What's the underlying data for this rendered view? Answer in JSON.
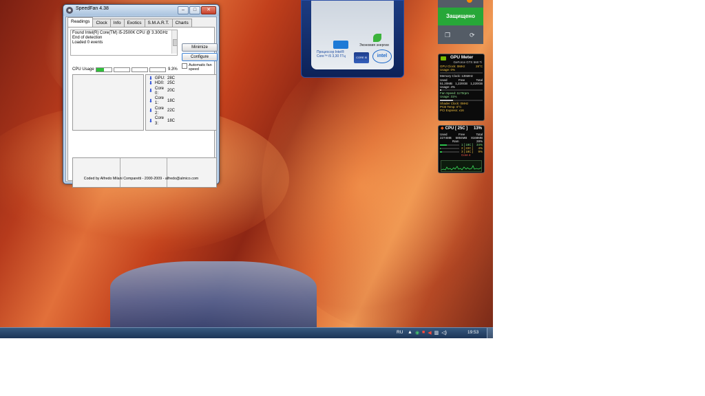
{
  "speedfan": {
    "title": "SpeedFan 4.38",
    "tabs": [
      "Readings",
      "Clock",
      "Info",
      "Exotics",
      "S.M.A.R.T.",
      "Charts"
    ],
    "log": [
      "Found Intel(R) Core(TM) i5-2500K CPU @ 3.30GHz",
      "End of detection",
      "Loaded 0 events"
    ],
    "minimize_label": "Minimize",
    "configure_label": "Configure",
    "auto_fan_label": "Automatic fan speed",
    "cpu_usage_label": "CPU Usage",
    "cpu_usage_value": "9.3%",
    "core_usage_fractions": [
      0.5,
      0,
      0,
      0
    ],
    "temps": [
      {
        "name": "GPU:",
        "value": "28C"
      },
      {
        "name": "HD0:",
        "value": "25C"
      },
      {
        "name": "Core 0:",
        "value": "20C"
      },
      {
        "name": "Core 1:",
        "value": "18C"
      },
      {
        "name": "Core 2:",
        "value": "22C"
      },
      {
        "name": "Core 3:",
        "value": "18C"
      }
    ],
    "footer": "Coded by Alfredo Milani Comparetti - 2000-2009 - alfredo@almico.com"
  },
  "intel_gadget": {
    "eco_label": "Экономия энергии",
    "processor_line1": "Процессор Intel®",
    "processor_line2": "Core™ i5 3,30 ГГц",
    "core_badge": "CORE i5",
    "logo": "intel"
  },
  "security": {
    "status": "Защищено"
  },
  "gpu_meter": {
    "title": "GPU Meter",
    "card": "GeForce GTX 560 Ti",
    "gpu_clock": "GPU Clock: 0MHz",
    "gpu_temp": "28°C",
    "usage": "Usage: 0%",
    "memory_clock": "Memory Clock: 135MHz",
    "mem_headers": [
      "Used",
      "Free",
      "Total"
    ],
    "mem_values": [
      "51.20MB",
      "1,220GB",
      "1,220GB"
    ],
    "mem_usage": "Usage: 4%",
    "fan_speed": "Fan Speed: 1170rpm",
    "fan_usage": "Usage: 31%",
    "shader_clock": "Shader Clock: 0MHz",
    "pcb_temp": "PCB Temp: 0°C",
    "pci_express": "PCI Express: x16",
    "usage_fraction": 0.0,
    "mem_usage_fraction": 0.04,
    "fan_usage_fraction": 0.31
  },
  "cpu_meter": {
    "title": "CPU [ 25C ]",
    "total_pct": "13%",
    "headers": [
      "Used",
      "Free",
      "Total"
    ],
    "values": [
      "2274MB",
      "5894MB",
      "8168MB"
    ],
    "ram_label": "Ram",
    "ram_pct": "28%",
    "cores": [
      {
        "label": "1 [ 18C ]",
        "pct": "34%",
        "fraction": 0.34
      },
      {
        "label": "2 [ 22C ]",
        "pct": "4%",
        "fraction": 0.04
      },
      {
        "label": "3 [ 18C ]",
        "pct": "9%",
        "fraction": 0.09
      }
    ],
    "core4": "Core 4"
  },
  "taskbar": {
    "language": "RU",
    "clock": "19:53"
  }
}
